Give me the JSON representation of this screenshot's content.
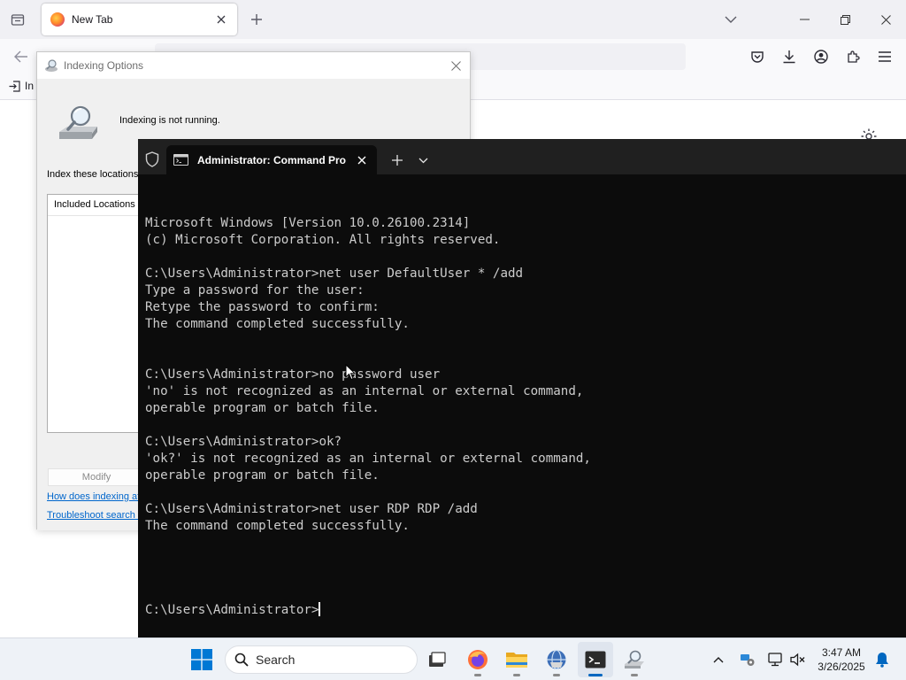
{
  "browser": {
    "tab_title": "New Tab",
    "bookmark_import_label": "In"
  },
  "indexing": {
    "title": "Indexing Options",
    "status": "Indexing is not running.",
    "heading": "Index these locations",
    "column_header": "Included Locations",
    "modify_label": "Modify",
    "link_how": "How does indexing af",
    "link_troubleshoot": "Troubleshoot search a"
  },
  "terminal": {
    "tab_title": "Administrator: Command Pro",
    "lines": [
      "Microsoft Windows [Version 10.0.26100.2314]",
      "(c) Microsoft Corporation. All rights reserved.",
      "",
      "C:\\Users\\Administrator>net user DefaultUser * /add",
      "Type a password for the user:",
      "Retype the password to confirm:",
      "The command completed successfully.",
      "",
      "",
      "C:\\Users\\Administrator>no password user",
      "'no' is not recognized as an internal or external command,",
      "operable program or batch file.",
      "",
      "C:\\Users\\Administrator>ok?",
      "'ok?' is not recognized as an internal or external command,",
      "operable program or batch file.",
      "",
      "C:\\Users\\Administrator>net user RDP RDP /add",
      "The command completed successfully.",
      "",
      ""
    ],
    "prompt": "C:\\Users\\Administrator>"
  },
  "taskbar": {
    "search_placeholder": "Search",
    "time": "3:47 AM",
    "date": "3/26/2025"
  },
  "colors": {
    "terminal_bg": "#0c0c0c",
    "terminal_fg": "#cccccc",
    "accent": "#0067c0"
  }
}
